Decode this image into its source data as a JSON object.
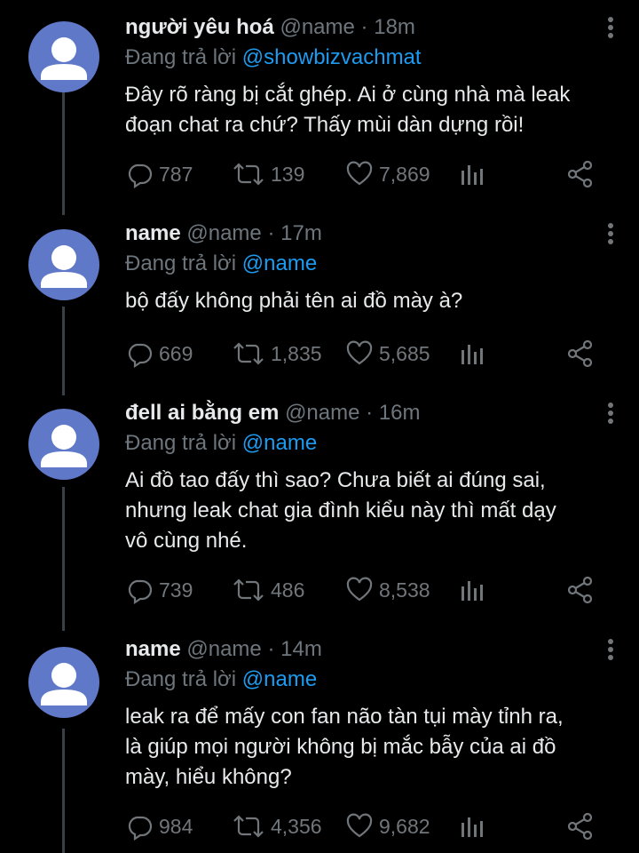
{
  "replying_prefix": "Đang trả lời",
  "tweets": [
    {
      "name": "người yêu hoá",
      "handle": "@name",
      "separator": "·",
      "time": "18m",
      "mention": "@showbizvachmat",
      "text": "Đây rõ ràng bị cắt ghép. Ai ở cùng nhà mà leak\nđoạn chat ra chứ? Thấy mùi dàn dựng rồi!",
      "replies": "787",
      "retweets": "139",
      "likes": "7,869"
    },
    {
      "name": "name",
      "handle": "@name",
      "separator": "·",
      "time": "17m",
      "mention": "@name",
      "text": "bộ đấy không phải tên ai đồ mày à?",
      "replies": "669",
      "retweets": "1,835",
      "likes": "5,685"
    },
    {
      "name": "đell ai bằng em",
      "handle": "@name",
      "separator": "·",
      "time": "16m",
      "mention": "@name",
      "text": "Ai đồ tao đấy thì sao? Chưa biết ai đúng sai,\nnhưng leak chat gia đình kiểu này thì mất dạy\nvô cùng nhé.",
      "replies": "739",
      "retweets": "486",
      "likes": "8,538"
    },
    {
      "name": "name",
      "handle": "@name",
      "separator": "·",
      "time": "14m",
      "mention": "@name",
      "text": "leak ra để mấy con fan não tàn tụi mày tỉnh ra,\nlà giúp mọi người không bị mắc bẫy của ai đồ\nmày, hiểu không?",
      "replies": "984",
      "retweets": "4,356",
      "likes": "9,682"
    }
  ],
  "colors": {
    "background": "#000000",
    "text": "#e7e9ea",
    "muted": "#6e767d",
    "mention": "#1d9bf0",
    "avatar": "#5f78c8"
  },
  "icons": [
    "reply-icon",
    "retweet-icon",
    "like-icon",
    "analytics-icon",
    "share-icon",
    "more-icon"
  ]
}
